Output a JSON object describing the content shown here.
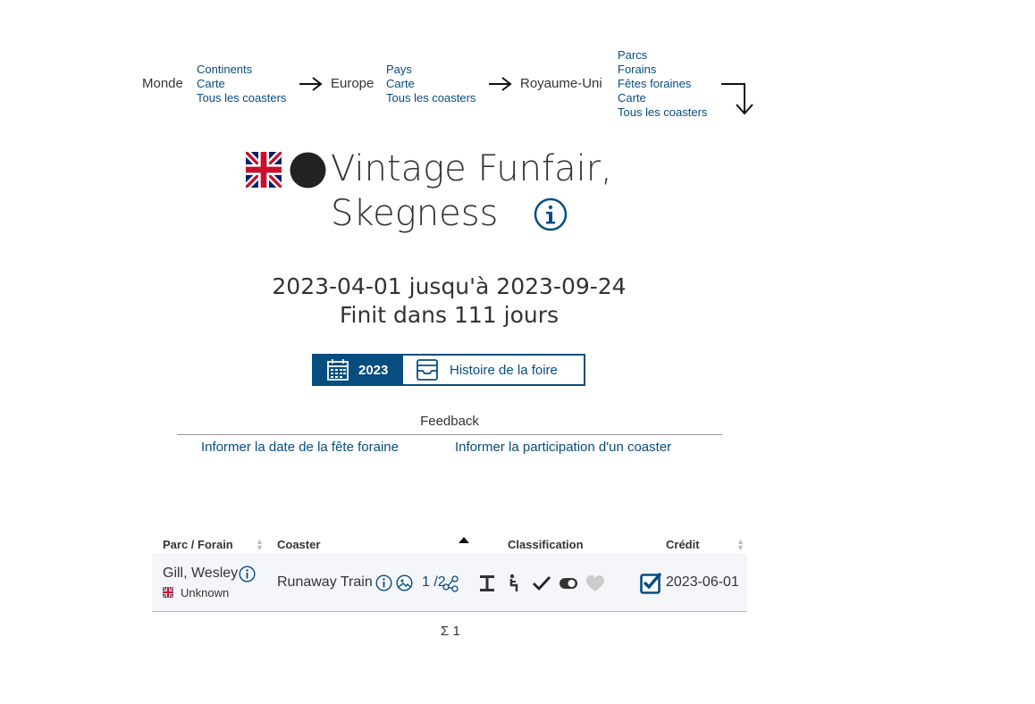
{
  "breadcrumb": {
    "world": {
      "label": "Monde",
      "links": [
        "Continents",
        "Carte",
        "Tous les coasters"
      ]
    },
    "continent": {
      "label": "Europe",
      "links": [
        "Pays",
        "Carte",
        "Tous les coasters"
      ]
    },
    "country": {
      "label": "Royaume-Uni",
      "links": [
        "Parcs",
        "Forains",
        "Fêtes foraines",
        "Carte",
        "Tous les coasters"
      ]
    }
  },
  "title": {
    "line1": "Vintage Funfair,",
    "line2": "Skegness"
  },
  "dates": {
    "range": "2023-04-01 jusqu'à 2023-09-24",
    "ends": "Finit dans 111 jours"
  },
  "view_toggle": {
    "year": "2023",
    "history": "Histoire de la foire"
  },
  "feedback": {
    "heading": "Feedback",
    "report_date": "Informer la date de la fête foraine",
    "report_coaster": "Informer la participation d'un coaster"
  },
  "table": {
    "headers": {
      "park": "Parc / Forain",
      "coaster": "Coaster",
      "classification": "Classification",
      "credit": "Crédit"
    },
    "rows": [
      {
        "park": "Gill, Wesley",
        "park_sub": "Unknown",
        "coaster": "Runaway Train",
        "count": "1 /2",
        "credit_date": "2023-06-01",
        "credited": true
      }
    ],
    "total": "Σ 1"
  },
  "colors": {
    "link": "#074d7f",
    "row_bg": "#f5f6fa",
    "heart": "#cccccc"
  },
  "icons": [
    "uk-flag-icon",
    "status-dot-icon",
    "info-icon",
    "calendar-icon",
    "archive-icon",
    "arrow-right-icon",
    "arrow-down-turn-icon",
    "sort-icon",
    "sort-up-icon",
    "photo-icon",
    "share-icon",
    "track-icon",
    "rider-icon",
    "check-icon",
    "toggle-icon",
    "heart-icon",
    "checkbox-checked-icon"
  ]
}
